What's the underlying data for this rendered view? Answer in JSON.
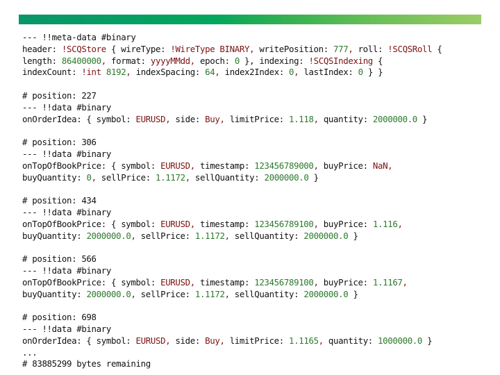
{
  "banner": {
    "gradient_colors": [
      "#0b956a",
      "#02a65c",
      "#6dbf58",
      "#9ccc65"
    ]
  },
  "syntax_colors": {
    "key": "#111111",
    "string": "#7b1212",
    "number": "#2b7a2b"
  },
  "document": {
    "lines": [
      [
        {
          "t": "k",
          "v": "--- !!meta-data #binary"
        }
      ],
      [
        {
          "t": "k",
          "v": "header: "
        },
        {
          "t": "s",
          "v": "!SCQStore"
        },
        {
          "t": "k",
          "v": " { wireType: "
        },
        {
          "t": "s",
          "v": "!WireType BINARY"
        },
        {
          "t": "p",
          "v": ","
        },
        {
          "t": "k",
          "v": " writePosition: "
        },
        {
          "t": "n",
          "v": "777"
        },
        {
          "t": "p",
          "v": ","
        },
        {
          "t": "k",
          "v": " roll: "
        },
        {
          "t": "s",
          "v": "!SCQSRoll"
        },
        {
          "t": "k",
          "v": " {"
        }
      ],
      [
        {
          "t": "k",
          "v": "length: "
        },
        {
          "t": "n",
          "v": "86400000"
        },
        {
          "t": "p",
          "v": ","
        },
        {
          "t": "k",
          "v": " format: "
        },
        {
          "t": "s",
          "v": "yyyyMMdd"
        },
        {
          "t": "p",
          "v": ","
        },
        {
          "t": "k",
          "v": " epoch: "
        },
        {
          "t": "n",
          "v": "0"
        },
        {
          "t": "k",
          "v": " }, indexing: "
        },
        {
          "t": "s",
          "v": "!SCQSIndexing"
        },
        {
          "t": "k",
          "v": " {"
        }
      ],
      [
        {
          "t": "k",
          "v": "indexCount: "
        },
        {
          "t": "s",
          "v": "!int"
        },
        {
          "t": "k",
          "v": " "
        },
        {
          "t": "n",
          "v": "8192"
        },
        {
          "t": "p",
          "v": ","
        },
        {
          "t": "k",
          "v": " indexSpacing: "
        },
        {
          "t": "n",
          "v": "64"
        },
        {
          "t": "p",
          "v": ","
        },
        {
          "t": "k",
          "v": " index2Index: "
        },
        {
          "t": "n",
          "v": "0"
        },
        {
          "t": "p",
          "v": ","
        },
        {
          "t": "k",
          "v": " lastIndex: "
        },
        {
          "t": "n",
          "v": "0"
        },
        {
          "t": "k",
          "v": " } }"
        }
      ],
      [],
      [
        {
          "t": "k",
          "v": "# position: 227"
        }
      ],
      [
        {
          "t": "k",
          "v": "--- !!data #binary"
        }
      ],
      [
        {
          "t": "k",
          "v": "onOrderIdea: { symbol: "
        },
        {
          "t": "s",
          "v": "EURUSD"
        },
        {
          "t": "p",
          "v": ","
        },
        {
          "t": "k",
          "v": " side: "
        },
        {
          "t": "s",
          "v": "Buy"
        },
        {
          "t": "p",
          "v": ","
        },
        {
          "t": "k",
          "v": " limitPrice: "
        },
        {
          "t": "n",
          "v": "1.118"
        },
        {
          "t": "p",
          "v": ","
        },
        {
          "t": "k",
          "v": " quantity: "
        },
        {
          "t": "n",
          "v": "2000000.0"
        },
        {
          "t": "k",
          "v": " }"
        }
      ],
      [],
      [
        {
          "t": "k",
          "v": "# position: 306"
        }
      ],
      [
        {
          "t": "k",
          "v": "--- !!data #binary"
        }
      ],
      [
        {
          "t": "k",
          "v": "onTopOfBookPrice: { symbol: "
        },
        {
          "t": "s",
          "v": "EURUSD"
        },
        {
          "t": "p",
          "v": ","
        },
        {
          "t": "k",
          "v": " timestamp: "
        },
        {
          "t": "n",
          "v": "123456789000"
        },
        {
          "t": "p",
          "v": ","
        },
        {
          "t": "k",
          "v": " buyPrice: "
        },
        {
          "t": "s",
          "v": "NaN"
        },
        {
          "t": "p",
          "v": ","
        }
      ],
      [
        {
          "t": "k",
          "v": "buyQuantity: "
        },
        {
          "t": "n",
          "v": "0"
        },
        {
          "t": "p",
          "v": ","
        },
        {
          "t": "k",
          "v": " sellPrice: "
        },
        {
          "t": "n",
          "v": "1.1172"
        },
        {
          "t": "p",
          "v": ","
        },
        {
          "t": "k",
          "v": " sellQuantity: "
        },
        {
          "t": "n",
          "v": "2000000.0"
        },
        {
          "t": "k",
          "v": " }"
        }
      ],
      [],
      [
        {
          "t": "k",
          "v": "# position: 434"
        }
      ],
      [
        {
          "t": "k",
          "v": "--- !!data #binary"
        }
      ],
      [
        {
          "t": "k",
          "v": "onTopOfBookPrice: { symbol: "
        },
        {
          "t": "s",
          "v": "EURUSD"
        },
        {
          "t": "p",
          "v": ","
        },
        {
          "t": "k",
          "v": " timestamp: "
        },
        {
          "t": "n",
          "v": "123456789100"
        },
        {
          "t": "p",
          "v": ","
        },
        {
          "t": "k",
          "v": " buyPrice: "
        },
        {
          "t": "n",
          "v": "1.116"
        },
        {
          "t": "p",
          "v": ","
        }
      ],
      [
        {
          "t": "k",
          "v": "buyQuantity: "
        },
        {
          "t": "n",
          "v": "2000000.0"
        },
        {
          "t": "p",
          "v": ","
        },
        {
          "t": "k",
          "v": " sellPrice: "
        },
        {
          "t": "n",
          "v": "1.1172"
        },
        {
          "t": "p",
          "v": ","
        },
        {
          "t": "k",
          "v": " sellQuantity: "
        },
        {
          "t": "n",
          "v": "2000000.0"
        },
        {
          "t": "k",
          "v": " }"
        }
      ],
      [],
      [
        {
          "t": "k",
          "v": "# position: 566"
        }
      ],
      [
        {
          "t": "k",
          "v": "--- !!data #binary"
        }
      ],
      [
        {
          "t": "k",
          "v": "onTopOfBookPrice: { symbol: "
        },
        {
          "t": "s",
          "v": "EURUSD"
        },
        {
          "t": "p",
          "v": ","
        },
        {
          "t": "k",
          "v": " timestamp: "
        },
        {
          "t": "n",
          "v": "123456789100"
        },
        {
          "t": "p",
          "v": ","
        },
        {
          "t": "k",
          "v": " buyPrice: "
        },
        {
          "t": "n",
          "v": "1.1167"
        },
        {
          "t": "p",
          "v": ","
        }
      ],
      [
        {
          "t": "k",
          "v": "buyQuantity: "
        },
        {
          "t": "n",
          "v": "2000000.0"
        },
        {
          "t": "p",
          "v": ","
        },
        {
          "t": "k",
          "v": " sellPrice: "
        },
        {
          "t": "n",
          "v": "1.1172"
        },
        {
          "t": "p",
          "v": ","
        },
        {
          "t": "k",
          "v": " sellQuantity: "
        },
        {
          "t": "n",
          "v": "2000000.0"
        },
        {
          "t": "k",
          "v": " }"
        }
      ],
      [],
      [
        {
          "t": "k",
          "v": "# position: 698"
        }
      ],
      [
        {
          "t": "k",
          "v": "--- !!data #binary"
        }
      ],
      [
        {
          "t": "k",
          "v": "onOrderIdea: { symbol: "
        },
        {
          "t": "s",
          "v": "EURUSD"
        },
        {
          "t": "p",
          "v": ","
        },
        {
          "t": "k",
          "v": " side: "
        },
        {
          "t": "s",
          "v": "Buy"
        },
        {
          "t": "p",
          "v": ","
        },
        {
          "t": "k",
          "v": " limitPrice: "
        },
        {
          "t": "n",
          "v": "1.1165"
        },
        {
          "t": "p",
          "v": ","
        },
        {
          "t": "k",
          "v": " quantity: "
        },
        {
          "t": "n",
          "v": "1000000.0"
        },
        {
          "t": "k",
          "v": " }"
        }
      ],
      [
        {
          "t": "k",
          "v": "..."
        }
      ],
      [
        {
          "t": "k",
          "v": "# 83885299 bytes remaining"
        }
      ]
    ]
  }
}
